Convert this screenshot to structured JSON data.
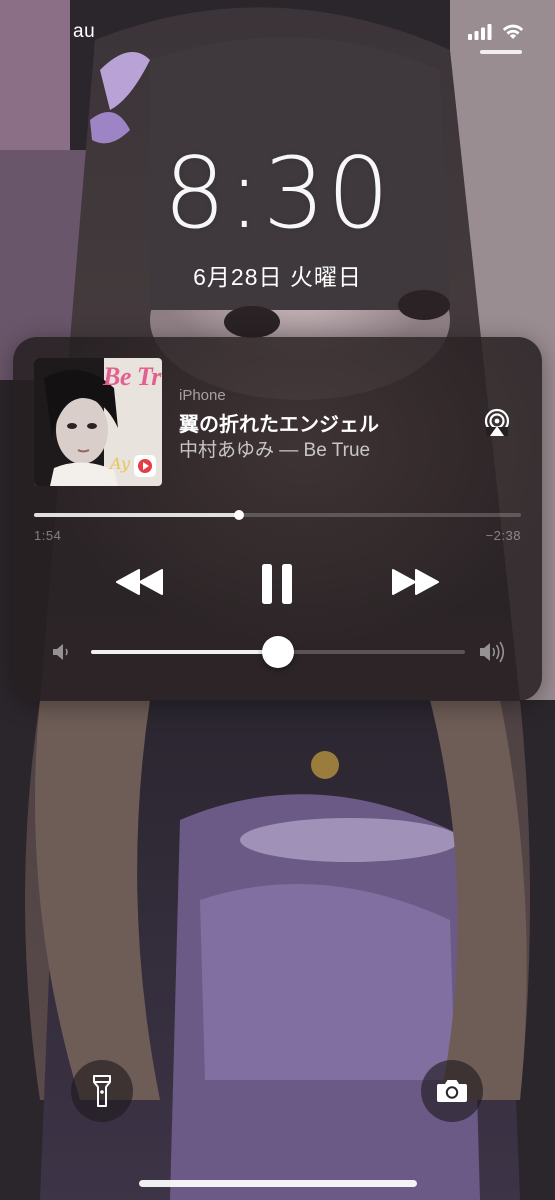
{
  "status_bar": {
    "carrier": "au",
    "signal_icon": "cellular-signal-icon",
    "wifi_icon": "wifi-icon"
  },
  "lock_screen": {
    "time": "8:30",
    "date": "6月28日 火曜日"
  },
  "now_playing": {
    "source": "iPhone",
    "title": "翼の折れたエンジェル",
    "artist_album": "中村あゆみ — Be True",
    "artwork": {
      "title": "Be True",
      "signature": "Ay",
      "badge_icon": "youtube-music-icon"
    },
    "elapsed": "1:54",
    "remaining": "−2:38",
    "progress": 0.42,
    "volume": 0.5,
    "controls": {
      "airplay_icon": "airplay-icon",
      "rewind_icon": "rewind-icon",
      "pause_icon": "pause-icon",
      "forward_icon": "fast-forward-icon",
      "volume_min_icon": "speaker-low-icon",
      "volume_max_icon": "speaker-high-icon"
    }
  },
  "quick_actions": {
    "flashlight_icon": "flashlight-icon",
    "camera_icon": "camera-icon"
  },
  "colors": {
    "accent_pink": "#e45f8f",
    "card_background": "#262022"
  }
}
